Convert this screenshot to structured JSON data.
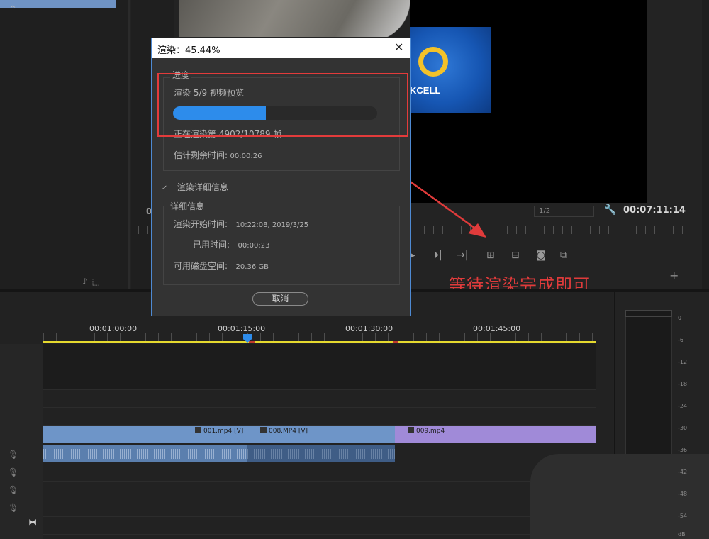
{
  "render_dialog": {
    "title": "渲染：45.44%",
    "close_glyph": "✕",
    "progress_section_label": "进度",
    "task_text": "渲染 5/9 视频预览",
    "progress_percent": 45.44,
    "frame_text": "正在渲染第 4902/10789 帧",
    "remaining_label": "估计剩余时间:",
    "remaining_value": "00:00:26",
    "details_toggle_label": "渲染详细信息",
    "details_section_label": "详细信息",
    "start_time_label": "渲染开始时间:",
    "start_time_value": "10:22:08, 2019/3/25",
    "elapsed_label": "已用时间:",
    "elapsed_value": "00:00:23",
    "disk_label": "可用磁盘空间:",
    "disk_value": "20.36 GB",
    "cancel_label": "取消"
  },
  "annotation": {
    "text": "等待渲染完成即可",
    "color": "#e03b3b"
  },
  "program_monitor": {
    "left_zero": "0",
    "fit_select_value": "1/2",
    "timecode": "00:07:11:14",
    "logo_text": "KCELL"
  },
  "timeline": {
    "timecodes": [
      "00:01:00:00",
      "00:01:15:00",
      "00:01:30:00",
      "00:01:45:00"
    ],
    "clips": {
      "clip_001": "001.mp4 [V]",
      "clip_008": "008.MP4 [V]",
      "clip_009": "009.mp4"
    }
  },
  "audio_meter": {
    "scale": [
      "0",
      "-6",
      "-12",
      "-18",
      "-24",
      "-30",
      "-36",
      "-42",
      "-48",
      "-54",
      "dB"
    ]
  },
  "icons": {
    "wrench": "wrench-icon",
    "close": "close-icon",
    "chevron": "chevron-down-icon",
    "mic": "microphone-icon",
    "add": "add-icon"
  },
  "colors": {
    "accent": "#2d8ceb",
    "highlight": "#e33b3b",
    "video_clip": "#6e95c8",
    "video_clip_alt": "#a08ad8",
    "work_area": "#e5d92e"
  }
}
